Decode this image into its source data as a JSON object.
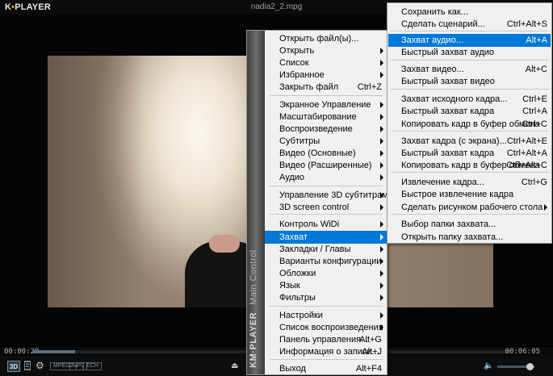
{
  "window": {
    "logo_text": "KMPLAYER",
    "title": "nadia2_2.mpg"
  },
  "player": {
    "time_elapsed": "00:00:28",
    "time_total": "00:06:05",
    "progress": 0.09,
    "btn_3d": "3D",
    "badges": [
      "MPEG2",
      "MP2",
      "ECH"
    ],
    "volume": 0.88
  },
  "main_menu": {
    "side_title": "KM·PLAYER",
    "side_subtitle": "Main Control",
    "items": [
      {
        "label": "Открыть файл(ы)...",
        "shortcut": "",
        "submenu": false
      },
      {
        "label": "Открыть",
        "shortcut": "",
        "submenu": true
      },
      {
        "label": "Список",
        "shortcut": "",
        "submenu": true
      },
      {
        "label": "Избранное",
        "shortcut": "",
        "submenu": true
      },
      {
        "label": "Закрыть файл",
        "shortcut": "Ctrl+Z",
        "submenu": false
      },
      {
        "label": "Экранное Управление",
        "shortcut": "",
        "submenu": true
      },
      {
        "label": "Масштабирование",
        "shortcut": "",
        "submenu": true
      },
      {
        "label": "Воспроизведение",
        "shortcut": "",
        "submenu": true
      },
      {
        "label": "Субтитры",
        "shortcut": "",
        "submenu": true
      },
      {
        "label": "Видео (Основные)",
        "shortcut": "",
        "submenu": true
      },
      {
        "label": "Видео (Расширенные)",
        "shortcut": "",
        "submenu": true
      },
      {
        "label": "Аудио",
        "shortcut": "",
        "submenu": true
      },
      {
        "label": "Управление 3D субтитрами",
        "shortcut": "",
        "submenu": true
      },
      {
        "label": "3D screen control",
        "shortcut": "",
        "submenu": true
      },
      {
        "label": "Контроль WiDi",
        "shortcut": "",
        "submenu": true
      },
      {
        "label": "Захват",
        "shortcut": "",
        "submenu": true,
        "highlighted": true
      },
      {
        "label": "Закладки / Главы",
        "shortcut": "",
        "submenu": true
      },
      {
        "label": "Варианты конфигурации",
        "shortcut": "",
        "submenu": true
      },
      {
        "label": "Обложки",
        "shortcut": "",
        "submenu": true
      },
      {
        "label": "Язык",
        "shortcut": "",
        "submenu": true
      },
      {
        "label": "Фильтры",
        "shortcut": "",
        "submenu": true
      },
      {
        "label": "Настройки",
        "shortcut": "",
        "submenu": true
      },
      {
        "label": "Список воспроизведения",
        "shortcut": "",
        "submenu": true
      },
      {
        "label": "Панель управления...",
        "shortcut": "Alt+G",
        "submenu": false
      },
      {
        "label": "Информация о записи...",
        "shortcut": "Alt+J",
        "submenu": false
      },
      {
        "label": "Выход",
        "shortcut": "Alt+F4",
        "submenu": false
      }
    ]
  },
  "capture_menu": {
    "items": [
      {
        "label": "Сохранить как...",
        "shortcut": "",
        "submenu": false
      },
      {
        "label": "Сделать сценарий...",
        "shortcut": "Ctrl+Alt+S",
        "submenu": false
      },
      {
        "label": "Захват аудио...",
        "shortcut": "Alt+A",
        "submenu": false,
        "highlighted": true
      },
      {
        "label": "Быстрый захват аудио",
        "shortcut": "",
        "submenu": false
      },
      {
        "label": "Захват видео...",
        "shortcut": "Alt+C",
        "submenu": false
      },
      {
        "label": "Быстрый захват видео",
        "shortcut": "",
        "submenu": false
      },
      {
        "label": "Захват исходного кадра...",
        "shortcut": "Ctrl+E",
        "submenu": false
      },
      {
        "label": "Быстрый захват кадра",
        "shortcut": "Ctrl+A",
        "submenu": false
      },
      {
        "label": "Копировать кадр в буфер обмена",
        "shortcut": "Ctrl+C",
        "submenu": false
      },
      {
        "label": "Захват кадра (с экрана)...",
        "shortcut": "Ctrl+Alt+E",
        "submenu": false
      },
      {
        "label": "Быстрый захват кадра",
        "shortcut": "Ctrl+Alt+A",
        "submenu": false
      },
      {
        "label": "Копировать кадр в буфер обмена",
        "shortcut": "Ctrl+Alt+C",
        "submenu": false
      },
      {
        "label": "Извлечение кадра...",
        "shortcut": "Ctrl+G",
        "submenu": false
      },
      {
        "label": "Быстрое извлечение кадра",
        "shortcut": "",
        "submenu": false
      },
      {
        "label": "Сделать рисунком рабочего стола",
        "shortcut": "",
        "submenu": true
      },
      {
        "label": "Выбор папки захвата...",
        "shortcut": "",
        "submenu": false
      },
      {
        "label": "Открыть папку захвата...",
        "shortcut": "",
        "submenu": false
      }
    ]
  }
}
